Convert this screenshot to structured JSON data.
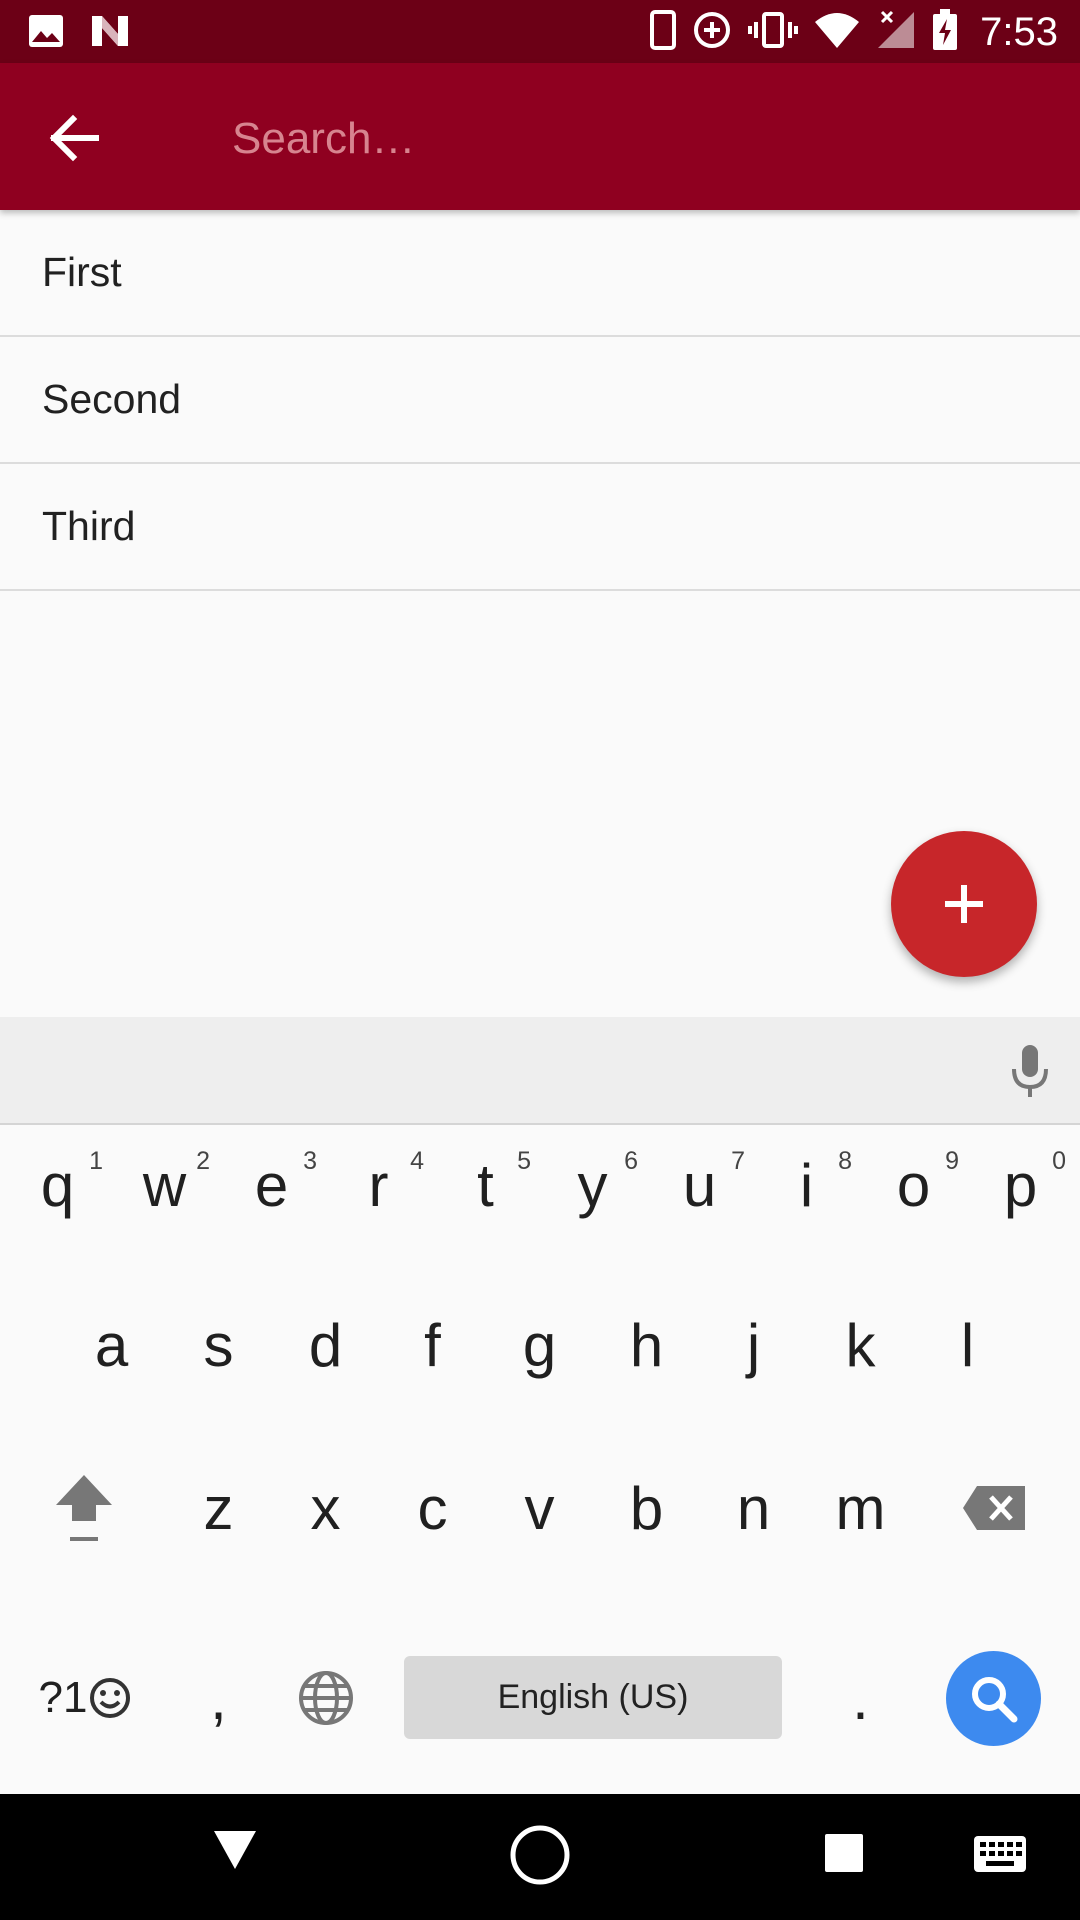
{
  "status_bar": {
    "time": "7:53",
    "left_icons": [
      "image-icon",
      "n-logo-icon"
    ],
    "right_icons": [
      "phone-icon",
      "data-saver-icon",
      "vibrate-icon",
      "wifi-icon",
      "no-signal-icon",
      "battery-charging-icon"
    ]
  },
  "app_bar": {
    "search_placeholder": "Search…",
    "search_value": ""
  },
  "list": {
    "items": [
      "First",
      "Second",
      "Third"
    ]
  },
  "fab": {
    "label": "+"
  },
  "keyboard": {
    "row1": [
      {
        "key": "q",
        "hint": "1"
      },
      {
        "key": "w",
        "hint": "2"
      },
      {
        "key": "e",
        "hint": "3"
      },
      {
        "key": "r",
        "hint": "4"
      },
      {
        "key": "t",
        "hint": "5"
      },
      {
        "key": "y",
        "hint": "6"
      },
      {
        "key": "u",
        "hint": "7"
      },
      {
        "key": "i",
        "hint": "8"
      },
      {
        "key": "o",
        "hint": "9"
      },
      {
        "key": "p",
        "hint": "0"
      }
    ],
    "row2": [
      "a",
      "s",
      "d",
      "f",
      "g",
      "h",
      "j",
      "k",
      "l"
    ],
    "row3": [
      "z",
      "x",
      "c",
      "v",
      "b",
      "n",
      "m"
    ],
    "symbols_label": "?1",
    "comma": ",",
    "period": ".",
    "space_label": "English (US)"
  },
  "colors": {
    "status_bar": "#6c0016",
    "app_bar": "#8f0020",
    "fab": "#c7262a",
    "search_key": "#3d8aef"
  }
}
